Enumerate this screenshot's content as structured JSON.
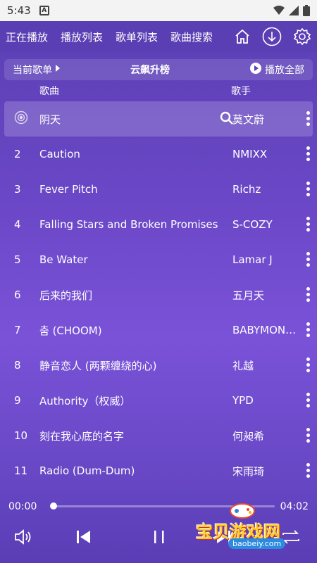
{
  "status": {
    "time": "5:43",
    "a_label": "A"
  },
  "nav": {
    "tabs": [
      "正在播放",
      "播放列表",
      "歌单列表",
      "歌曲搜索"
    ]
  },
  "header": {
    "current_playlist_label": "当前歌单",
    "playlist_title": "云飙升榜",
    "play_all_label": "播放全部"
  },
  "columns": {
    "song": "歌曲",
    "artist": "歌手"
  },
  "songs": [
    {
      "num": "",
      "name": "阴天",
      "artist": "莫文蔚",
      "active": true
    },
    {
      "num": "2",
      "name": "Caution",
      "artist": "NMIXX"
    },
    {
      "num": "3",
      "name": "Fever Pitch",
      "artist": "Richz"
    },
    {
      "num": "4",
      "name": "Falling Stars and Broken Promises",
      "artist": "S-COZY"
    },
    {
      "num": "5",
      "name": "Be Water",
      "artist": "Lamar J"
    },
    {
      "num": "6",
      "name": "后来的我们",
      "artist": "五月天"
    },
    {
      "num": "7",
      "name": "춤 (CHOOM)",
      "artist": "BABYMON…"
    },
    {
      "num": "8",
      "name": "静音恋人 (两颗缠绕的心)",
      "artist": "礼越"
    },
    {
      "num": "9",
      "name": "Authority（权威）",
      "artist": "YPD"
    },
    {
      "num": "10",
      "name": "刻在我心底的名字",
      "artist": "何昶希"
    },
    {
      "num": "11",
      "name": "Radio (Dum-Dum)",
      "artist": "宋雨琦"
    }
  ],
  "player": {
    "elapsed": "00:00",
    "duration": "04:02",
    "progress": 0
  },
  "watermark": {
    "text": "宝贝游戏网",
    "url": "baobeiy.com"
  }
}
